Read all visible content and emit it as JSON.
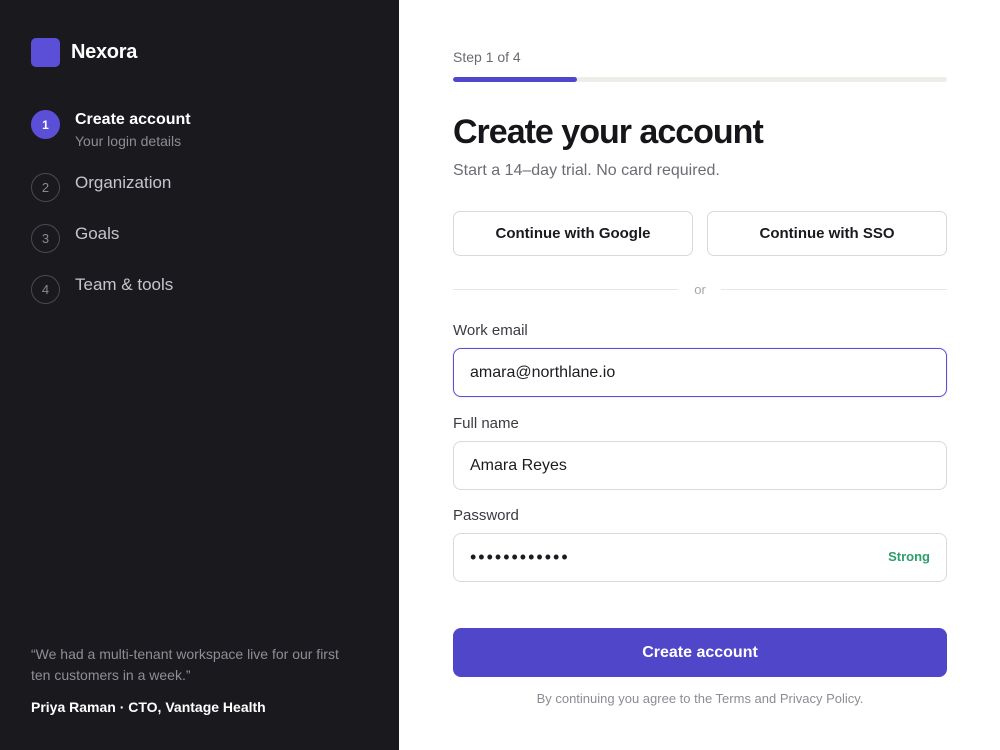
{
  "brand": {
    "name": "Nexora",
    "accent": "#5b4fd8"
  },
  "steps": [
    {
      "number": "1",
      "title": "Create account",
      "subtitle": "Your login details",
      "active": true
    },
    {
      "number": "2",
      "title": "Organization"
    },
    {
      "number": "3",
      "title": "Goals"
    },
    {
      "number": "4",
      "title": "Team & tools"
    }
  ],
  "testimonial": {
    "quote": "“We had a multi-tenant workspace live for our first ten customers in a week.”",
    "author": "Priya Raman · CTO, Vantage Health"
  },
  "form": {
    "step_label": "Step 1 of 4",
    "progress": 0.25,
    "title": "Create your account",
    "subtitle": "Start a 14–day trial. No card required.",
    "google_button": "Continue with Google",
    "sso_button": "Continue with SSO",
    "divider": "or",
    "email_label": "Work email",
    "email_value": "amara@northlane.io",
    "name_label": "Full name",
    "name_value": "Amara Reyes",
    "password_label": "Password",
    "password_masked": "••••••••••••",
    "password_strength": "Strong",
    "submit": "Create account",
    "terms": "By continuing you agree to the Terms and Privacy Policy."
  }
}
